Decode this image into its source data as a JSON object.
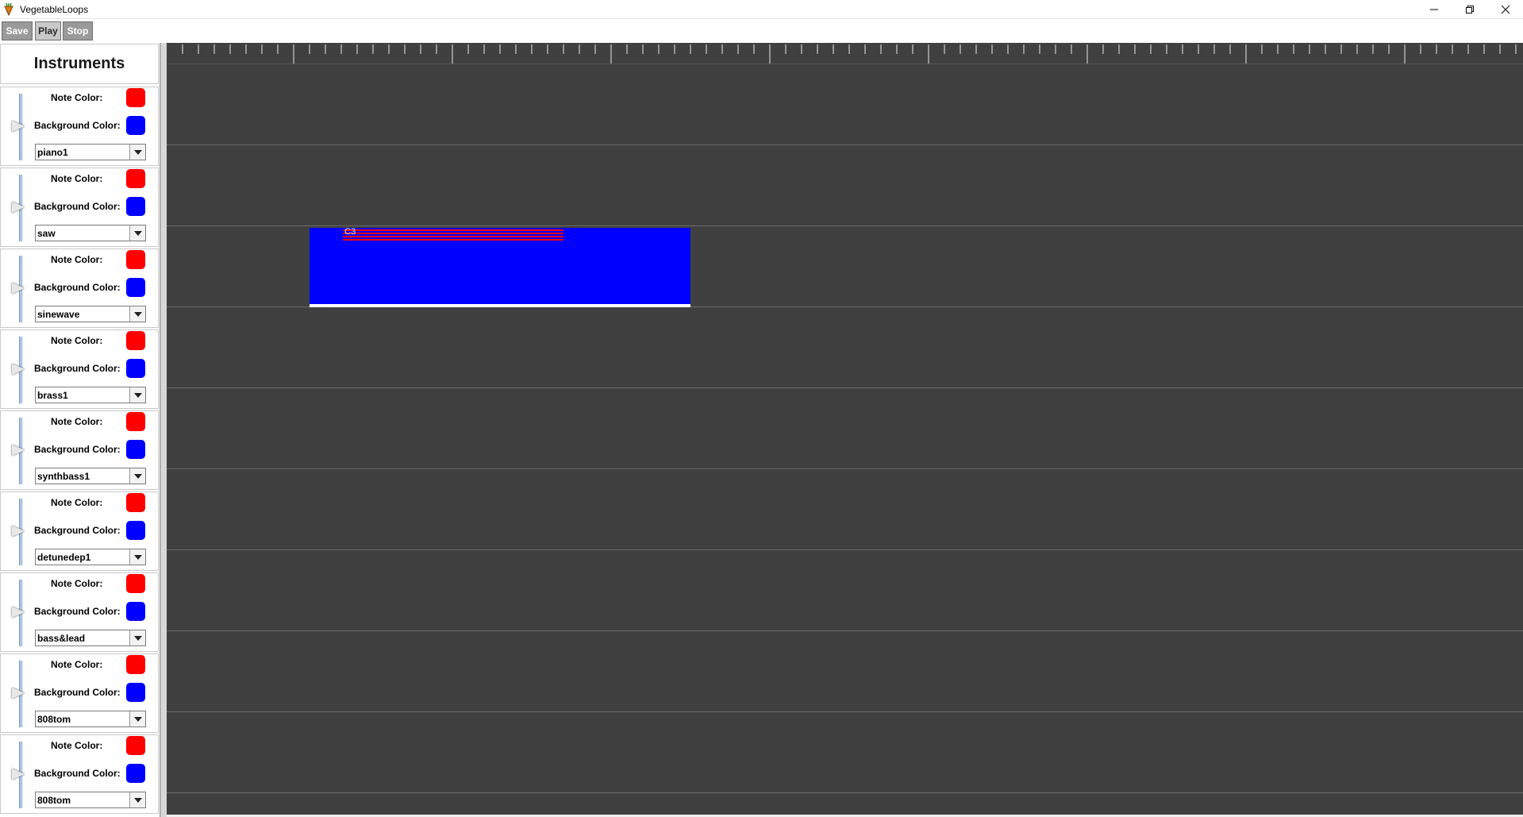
{
  "window": {
    "title": "VegetableLoops",
    "icon": "vegetable-app-icon",
    "controls": [
      "minimize-icon",
      "maximize-icon",
      "close-icon"
    ]
  },
  "toolbar": {
    "save_label": "Save",
    "play_label": "Play",
    "stop_label": "Stop"
  },
  "instruments_panel": {
    "title": "Instruments",
    "note_color_label": "Note Color:",
    "background_color_label": "Background Color:",
    "note_color": "#ff0000",
    "background_color": "#0000ff",
    "tracks": [
      {
        "instrument": "piano1"
      },
      {
        "instrument": "saw"
      },
      {
        "instrument": "sinewave"
      },
      {
        "instrument": "brass1"
      },
      {
        "instrument": "synthbass1"
      },
      {
        "instrument": "detunedep1"
      },
      {
        "instrument": "bass&lead"
      },
      {
        "instrument": "808tom"
      },
      {
        "instrument": "808tom"
      }
    ]
  },
  "timeline": {
    "background": "#404040",
    "clips": [
      {
        "track": 3,
        "label": "C3",
        "clip_color": "#0000ff",
        "note_color": "#ff0000"
      }
    ]
  }
}
